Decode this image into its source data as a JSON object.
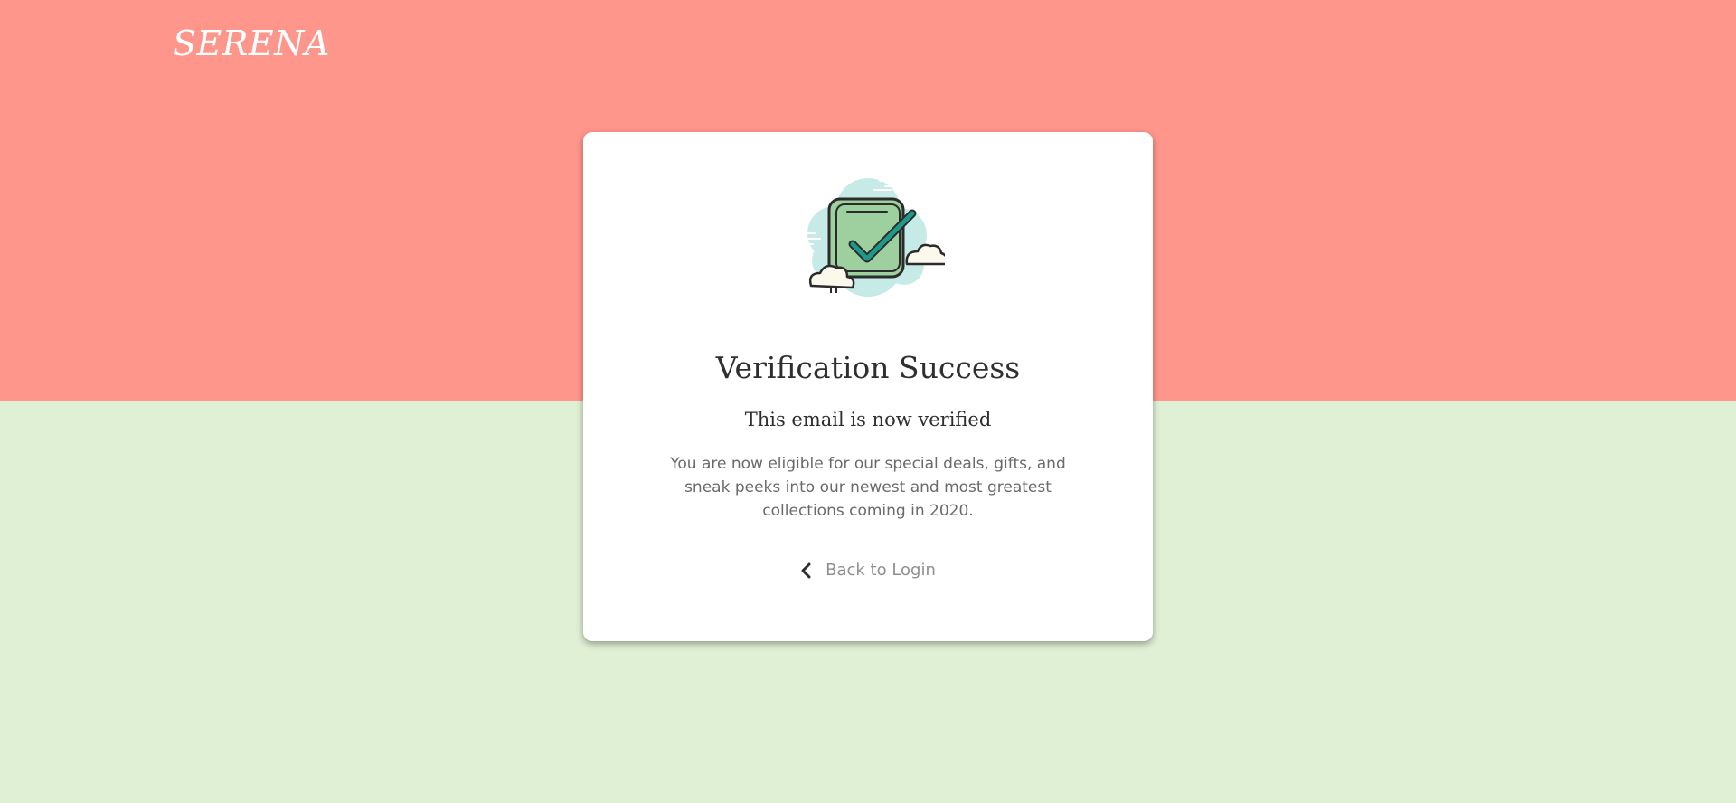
{
  "brand": {
    "name": "SERENA"
  },
  "colors": {
    "top_background": "#ff968b",
    "bottom_background": "#e0f0d4",
    "card_background": "#ffffff",
    "heading_text": "#2f2f2f",
    "body_text": "#6a6a6a",
    "link_text": "#8f8f8f",
    "check_fill": "#9dcf9f",
    "check_mark": "#1d9a8a",
    "cloud_fill": "#c6ebe6"
  },
  "card": {
    "icon": "verified-checkbox-icon",
    "title": "Verification Success",
    "subtitle": "This email is now verified",
    "message": "You are now eligible for our special deals, gifts, and sneak peeks into our newest and most greatest collections coming in 2020.",
    "back_link": {
      "icon": "chevron-left-icon",
      "label": "Back to Login"
    }
  }
}
